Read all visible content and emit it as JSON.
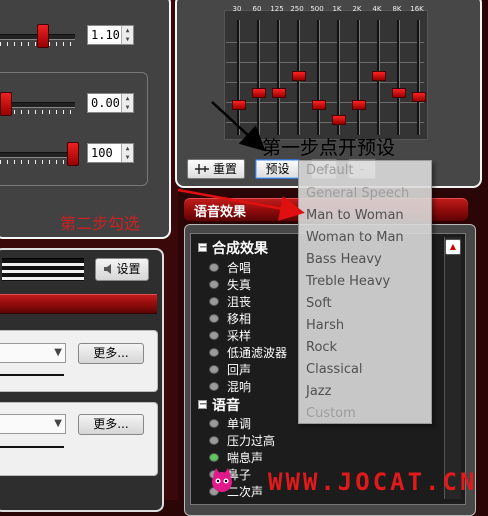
{
  "left": {
    "spin_top": "1.10",
    "spin_middle": "0.00",
    "spin_bottom": "100",
    "annotation_step2": "第二步勾选",
    "settings_button": "设置",
    "more_button_1": "更多...",
    "more_button_2": "更多..."
  },
  "equalizer": {
    "bands": [
      "30",
      "60",
      "125",
      "250",
      "500",
      "1K",
      "2K",
      "4K",
      "8K",
      "16K"
    ],
    "band_levels": [
      0.73,
      0.63,
      0.63,
      0.48,
      0.73,
      0.86,
      0.73,
      0.48,
      0.63,
      0.66
    ],
    "reset_button": "重置",
    "preset_button": "预设",
    "plus_button": "+",
    "minus_button": "-",
    "annotation_step1": "第一步点开预设"
  },
  "voice_effects": {
    "header": "语音效果",
    "groups": [
      {
        "title": "合成效果",
        "items": [
          "合唱",
          "失真",
          "沮丧",
          "移相",
          "采样",
          "低通滤波器",
          "回声",
          "混响"
        ]
      },
      {
        "title": "语音",
        "items": [
          "单调",
          "压力过高",
          "喘息声",
          "鼻子",
          "二次声"
        ]
      }
    ],
    "checked_item": "喘息声"
  },
  "preset_menu": {
    "items": [
      "Default",
      "General Speech",
      "Man to Woman",
      "Woman to Man",
      "Bass Heavy",
      "Treble Heavy",
      "Soft",
      "Harsh",
      "Rock",
      "Classical",
      "Jazz",
      "Custom"
    ],
    "dimmed": [
      "Default",
      "General Speech",
      "Custom"
    ]
  },
  "watermark": "WWW.JOCAT.CN",
  "colors": {
    "accent_red": "#c01b1b",
    "annotation_red": "#cc2222",
    "checked_green": "#5ec45e"
  }
}
